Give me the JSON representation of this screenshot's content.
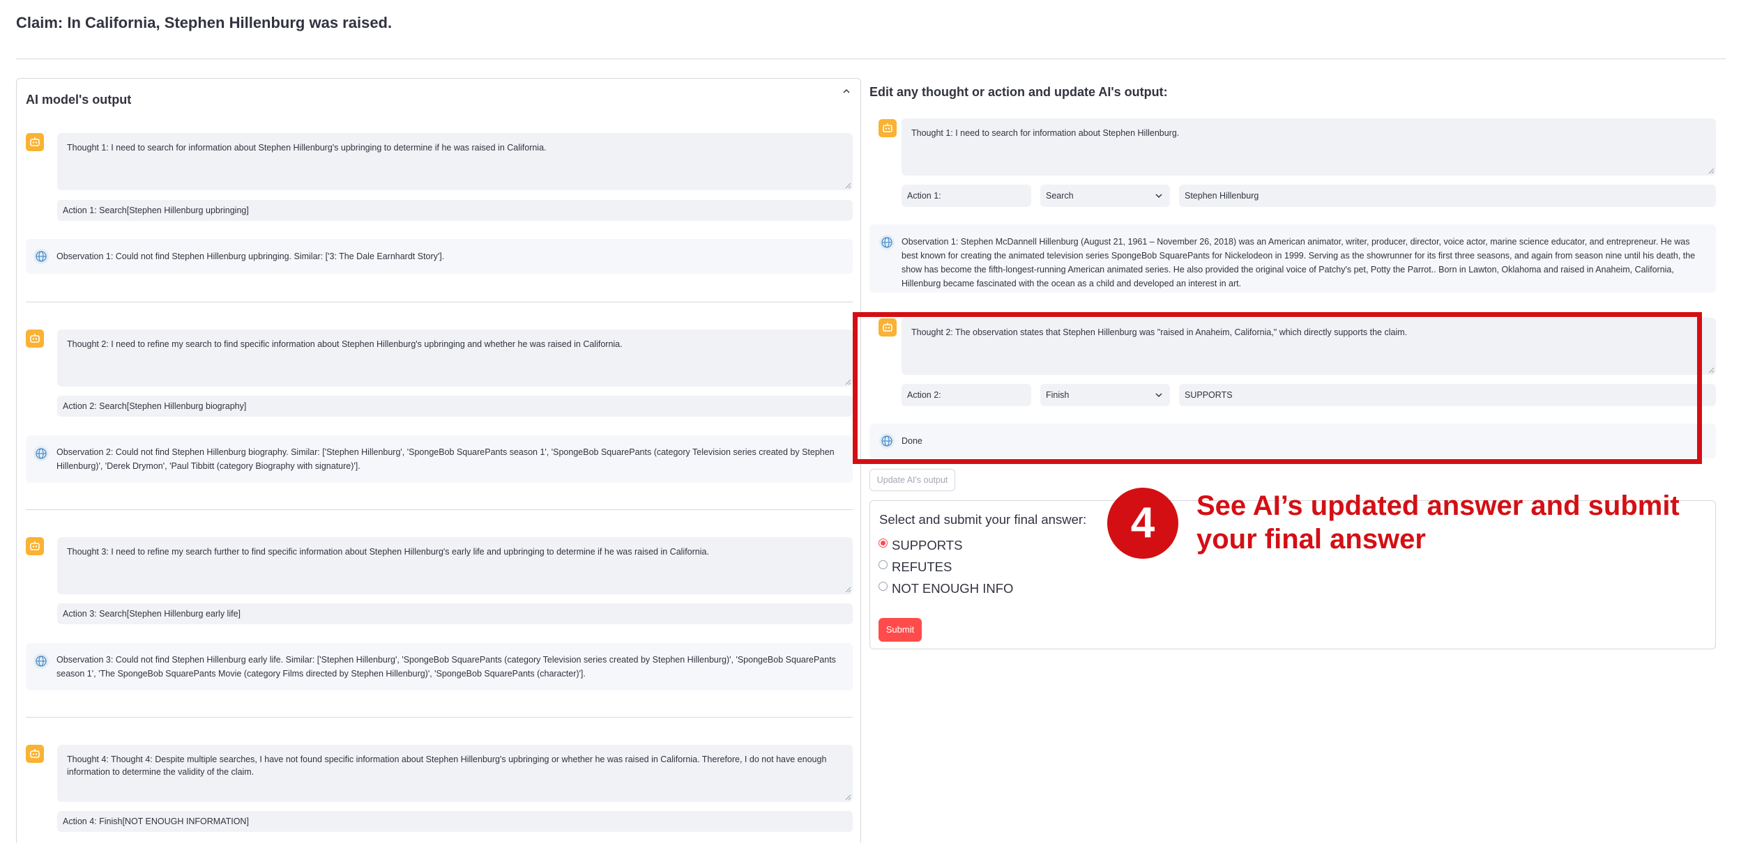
{
  "claim": "Claim: In California, Stephen Hillenburg was raised.",
  "left_panel": {
    "title": "AI model's output",
    "steps": [
      {
        "thought": "Thought 1: I need to search for information about Stephen Hillenburg's upbringing to determine if he was raised in California.",
        "action": "Action 1: Search[Stephen Hillenburg upbringing]",
        "observation": "Observation 1: Could not find Stephen Hillenburg upbringing. Similar: ['3: The Dale Earnhardt Story']."
      },
      {
        "thought": "Thought 2: I need to refine my search to find specific information about Stephen Hillenburg's upbringing and whether he was raised in California.",
        "action": "Action 2: Search[Stephen Hillenburg biography]",
        "observation": "Observation 2: Could not find Stephen Hillenburg biography. Similar: ['Stephen Hillenburg', 'SpongeBob SquarePants season 1', 'SpongeBob SquarePants (category Television series created by Stephen Hillenburg)', 'Derek Drymon', 'Paul Tibbitt (category Biography with signature)']."
      },
      {
        "thought": "Thought 3: I need to refine my search further to find specific information about Stephen Hillenburg's early life and upbringing to determine if he was raised in California.",
        "action": "Action 3: Search[Stephen Hillenburg early life]",
        "observation": "Observation 3: Could not find Stephen Hillenburg early life. Similar: ['Stephen Hillenburg', 'SpongeBob SquarePants (category Television series created by Stephen Hillenburg)', 'SpongeBob SquarePants season 1', 'The SpongeBob SquarePants Movie (category Films directed by Stephen Hillenburg)', 'SpongeBob SquarePants (character)']."
      },
      {
        "thought": "Thought 4: Thought 4: Despite multiple searches, I have not found specific information about Stephen Hillenburg's upbringing or whether he was raised in California. Therefore, I do not have enough information to determine the validity of the claim.",
        "action": "Action 4: Finish[NOT ENOUGH INFORMATION]"
      }
    ]
  },
  "right_panel": {
    "title": "Edit any thought or action and update AI's output:",
    "step1": {
      "thought": "Thought 1: I need to search for information about Stephen Hillenburg.",
      "action_label": "Action 1:",
      "action_type": "Search",
      "action_arg": "Stephen Hillenburg",
      "observation": "Observation 1: Stephen McDannell Hillenburg (August 21, 1961 – November 26, 2018) was an American animator, writer, producer, director, voice actor, marine science educator, and entrepreneur. He was best known for creating the animated television series SpongeBob SquarePants for Nickelodeon in 1999. Serving as the showrunner for its first three seasons, and again from season nine until his death, the show has become the fifth-longest-running American animated series. He also provided the original voice of Patchy's pet, Potty the Parrot.. Born in Lawton, Oklahoma and raised in Anaheim, California, Hillenburg became fascinated with the ocean as a child and developed an interest in art."
    },
    "step2": {
      "thought": "Thought 2: The observation states that Stephen Hillenburg was \"raised in Anaheim, California,\" which directly supports the claim.",
      "action_label": "Action 2:",
      "action_type": "Finish",
      "action_arg": "SUPPORTS",
      "observation": "Done"
    },
    "update_button": "Update AI's output",
    "final": {
      "label": "Select and submit your final answer:",
      "options": [
        "SUPPORTS",
        "REFUTES",
        "NOT ENOUGH INFO"
      ],
      "selected": "SUPPORTS",
      "submit": "Submit"
    }
  },
  "annotation": {
    "step_number": "4",
    "text": "See AI’s updated answer and submit your final answer"
  },
  "colors": {
    "accent_red": "#d40f14",
    "button_red": "#ff4b4b",
    "bot_icon": "#f9b233",
    "field_bg": "#f0f2f6"
  }
}
